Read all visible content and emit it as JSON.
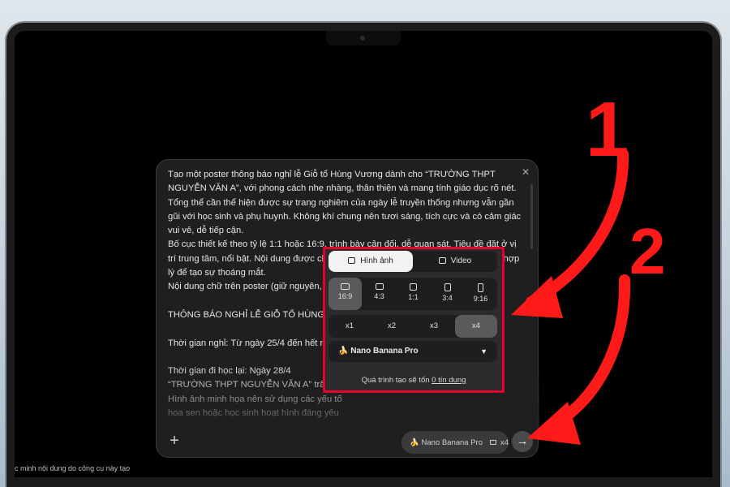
{
  "prompt": {
    "text": "Tạo một poster thông báo nghỉ lễ Giỗ tổ Hùng Vương dành cho “TRƯỜNG THPT NGUYỄN VĂN A”, với phong cách nhẹ nhàng, thân thiện và mang tính giáo dục rõ nét. Tổng thể cần thể hiện được sự trang nghiêm của ngày lễ truyền thống nhưng vẫn gần gũi với học sinh và phụ huynh. Không khí chung nên tươi sáng, tích cực và có cảm giác vui vẻ, dễ tiếp cận.\nBố cục thiết kế theo tỷ lệ 1:1 hoặc 16:9, trình bày cân đối, dễ quan sát. Tiêu đề đặt ở vị trí trung tâm, nổi bật. Nội dung được chia thành từng khối rõ ràng, có khoảng trống hợp lý để tạo sự thoáng mắt.\nNội dung chữ trên poster (giữ nguyên, khô\n\nTHÔNG BÁO NGHỈ LỄ GIỖ TỔ HÙNG VƯƠ\n\nThời gian nghỉ: Từ ngày 25/4 đến hết ngày\n\nThời gian đi học lại: Ngày 28/4\n“TRƯỜNG THPT NGUYỄN VĂN A” trân trọ\nHình ảnh minh họa nên sử dụng các yếu tố\nhoa sen hoặc học sinh hoạt hình đáng yêu\ntrường học đường. Font chữ rõ ràng, dễ đ\nlượng cao, không lỗi chữ, không watermar"
  },
  "footer": {
    "disclaimer": "c minh nội dung do công cụ này tạo"
  },
  "settings": {
    "tabs": [
      {
        "label": "Hình ảnh",
        "icon": "image-icon",
        "active": true
      },
      {
        "label": "Video",
        "icon": "video-icon",
        "active": false
      }
    ],
    "aspect_ratios": [
      {
        "label": "16:9",
        "selected": true
      },
      {
        "label": "4:3",
        "selected": false
      },
      {
        "label": "1:1",
        "selected": false
      },
      {
        "label": "3:4",
        "selected": false
      },
      {
        "label": "9:16",
        "selected": false
      }
    ],
    "counts": [
      {
        "label": "x1",
        "selected": false
      },
      {
        "label": "x2",
        "selected": false
      },
      {
        "label": "x3",
        "selected": false
      },
      {
        "label": "x4",
        "selected": true
      }
    ],
    "model": "🍌 Nano Banana Pro",
    "cost_prefix": "Quá trình tạo sẽ tốn ",
    "cost_link": "0 tín dụng"
  },
  "chip": {
    "model": "🍌 Nano Banana Pro",
    "count": "x4"
  },
  "annotations": {
    "one": "1",
    "two": "2",
    "color": "#ff1a1a",
    "highlight_color": "#e4002b"
  }
}
